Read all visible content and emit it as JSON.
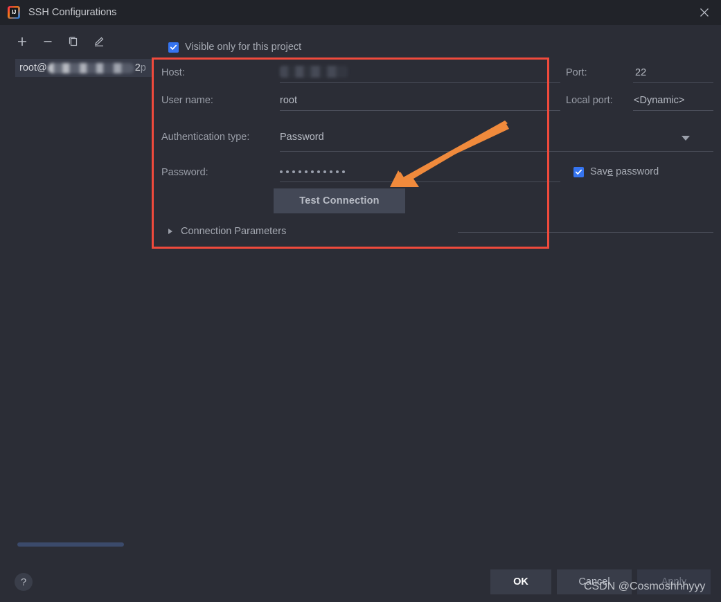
{
  "window": {
    "title": "SSH Configurations",
    "app_icon": "intellij-idea-icon",
    "close_icon": "close-icon"
  },
  "sidebar": {
    "toolbar": [
      {
        "name": "add-button",
        "icon": "plus-icon",
        "label": "+"
      },
      {
        "name": "remove-button",
        "icon": "minus-icon",
        "label": "−"
      },
      {
        "name": "copy-button",
        "icon": "copy-icon",
        "label": ""
      },
      {
        "name": "edit-button",
        "icon": "pencil-icon",
        "label": ""
      }
    ],
    "items": [
      {
        "prefix": "root@",
        "host_redacted": true,
        "port": "2",
        "suffix": " p",
        "selected": true
      }
    ],
    "scrollbar": {
      "name": "horizontal-scrollbar",
      "color": "#3b4a6b"
    }
  },
  "form": {
    "visible_only_checkbox": {
      "label": "Visible only for this project",
      "checked": true
    },
    "fields": {
      "host": {
        "label": "Host:",
        "value": "",
        "redacted": true
      },
      "username": {
        "label": "User name:",
        "value": "root"
      },
      "auth_type": {
        "label": "Authentication type:",
        "value": "Password"
      },
      "password": {
        "label": "Password:",
        "value": "•••••••••••",
        "dot_count": 11
      },
      "port": {
        "label": "Port:",
        "value": "22"
      },
      "local_port": {
        "label": "Local port:",
        "value": "<Dynamic>"
      }
    },
    "save_password_checkbox": {
      "label_before": "Sav",
      "label_mnemonic": "e",
      "label_after": " password",
      "checked": true
    },
    "test_connection_button": {
      "label": "Test Connection"
    },
    "connection_parameters": {
      "label": "Connection Parameters",
      "expanded": false
    }
  },
  "annotations": {
    "highlight_box_color": "#f04a3c",
    "arrow_color": "#f08a3c",
    "watermark": "CSDN @Cosmoshhhyyy"
  },
  "footer": {
    "help_button": "?",
    "ok_button": "OK",
    "cancel_button": "Cancel",
    "apply_button": "Apply",
    "apply_disabled": true
  }
}
